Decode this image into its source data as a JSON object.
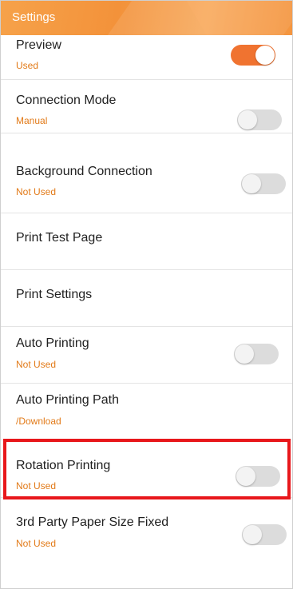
{
  "header": {
    "title": "Settings"
  },
  "settings": [
    {
      "title": "Preview",
      "subtitle": "Used",
      "toggle": true,
      "on": true
    },
    {
      "title": "Connection Mode",
      "subtitle": "Manual",
      "toggle": true,
      "on": false
    },
    {
      "title": "Background Connection",
      "subtitle": "Not Used",
      "toggle": true,
      "on": false
    },
    {
      "title": "Print Test Page",
      "subtitle": "",
      "toggle": false
    },
    {
      "title": "Print Settings",
      "subtitle": "",
      "toggle": false
    },
    {
      "title": "Auto Printing",
      "subtitle": "Not Used",
      "toggle": true,
      "on": false
    },
    {
      "title": "Auto Printing Path",
      "subtitle": "/Download",
      "toggle": false
    },
    {
      "title": "Rotation Printing",
      "subtitle": "Not Used",
      "toggle": true,
      "on": false
    },
    {
      "title": "3rd Party Paper Size Fixed",
      "subtitle": "Not Used",
      "toggle": true,
      "on": false
    }
  ],
  "colors": {
    "accent": "#f07330",
    "subtitle": "#e27a18",
    "highlight": "#e8171b"
  }
}
